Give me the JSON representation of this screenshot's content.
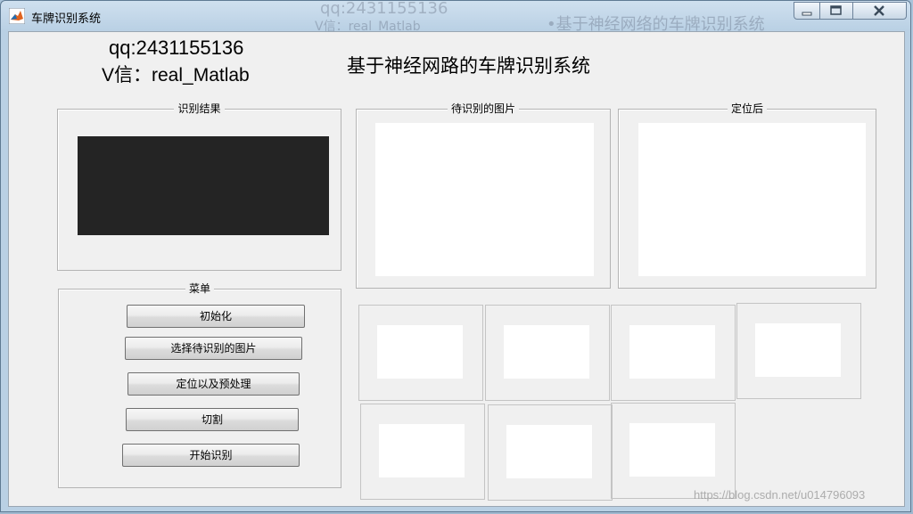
{
  "window": {
    "title": "车牌识别系统",
    "background_ghost": {
      "qq": "qq:2431155136",
      "wechat": "V信：real_Matlab",
      "title": "•基于神经网络的车牌识别系统"
    }
  },
  "header": {
    "qq": "qq:2431155136",
    "wechat": "V信：real_Matlab",
    "system_title": "基于神经网路的车牌识别系统"
  },
  "panels": {
    "result_title": "识别结果",
    "input_title": "待识别的图片",
    "located_title": "定位后",
    "menu_title": "菜单"
  },
  "menu": {
    "buttons": [
      "初始化",
      "选择待识别的图片",
      "定位以及预处理",
      "切割",
      "开始识别"
    ]
  },
  "watermark": "https://blog.csdn.net/u014796093",
  "colors": {
    "panel_bg": "#f0f0f0",
    "result_display": "#242424",
    "axes_bg": "#ffffff"
  }
}
